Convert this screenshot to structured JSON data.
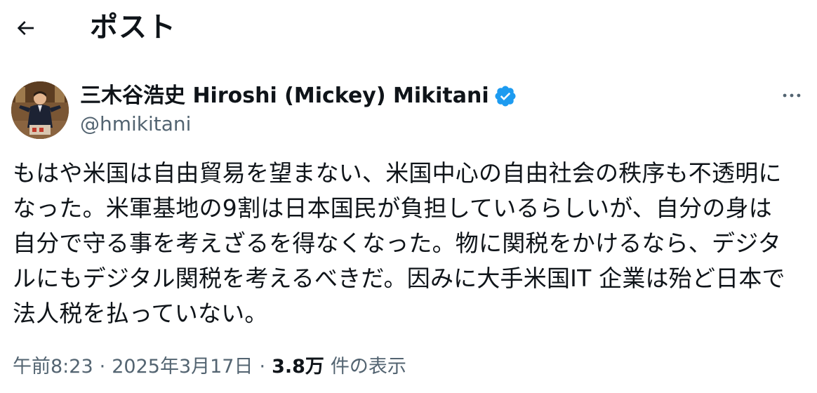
{
  "header": {
    "title": "ポスト",
    "back_icon": "arrow-left-icon"
  },
  "author": {
    "name": "三木谷浩史 Hiroshi (Mickey) Mikitani",
    "handle": "@hmikitani",
    "verified": true,
    "verified_color": "#1d9bf0"
  },
  "post": {
    "lines": [
      "もはや米国は自由貿易を望まない、米国中心の自由社会の秩序も不透明に",
      "なった。米軍基地の9割は日本国民が負担しているらしいが、自分の身は",
      "自分で守る事を考えざるを得なくなった。物に関税をかけるなら、デジタ",
      "ルにもデジタル関税を考えるべきだ。因みに大手米国IT 企業は殆ど日本で",
      "法人税を払っていない。"
    ]
  },
  "meta": {
    "time": "午前8:23",
    "separator": "·",
    "date": "2025年3月17日",
    "views_count": "3.8万",
    "views_label": "件の表示"
  },
  "colors": {
    "text_primary": "#0f1419",
    "text_secondary": "#536471",
    "background": "#ffffff"
  }
}
